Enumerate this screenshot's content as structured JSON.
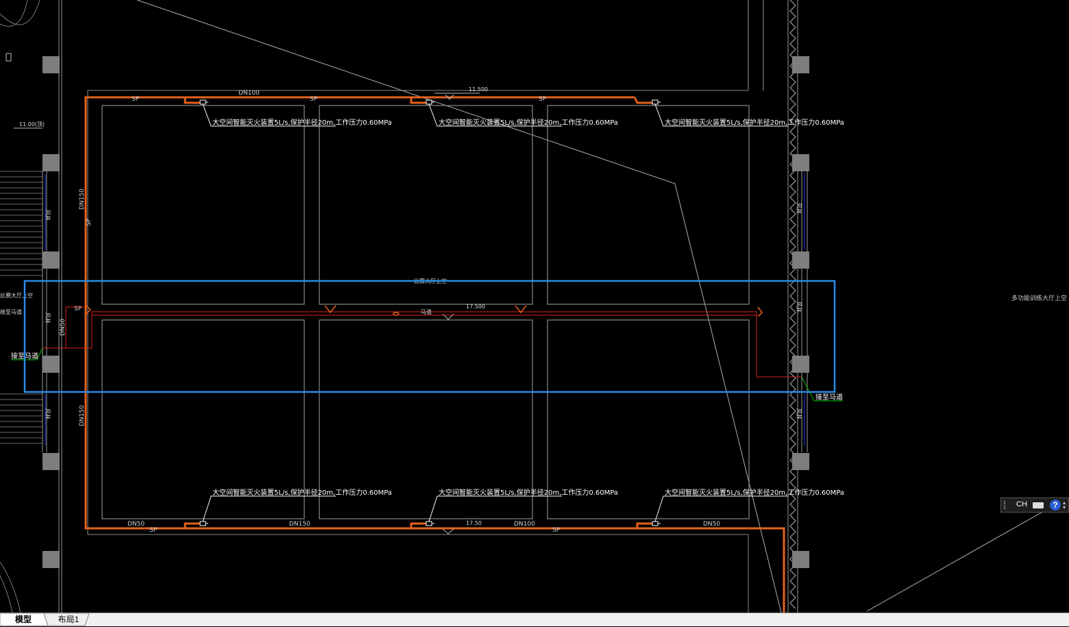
{
  "drawing": {
    "device_label": "大空间智能灭火装置5L/s,保护半径20m,工作压力0.60MPa",
    "device_label_alt": "大空间智能灭火装置5L/s,保护半径20m,工作压力0.60MPa",
    "pipe_labels": {
      "dn100": "DN100",
      "dn150": "DN150",
      "dn50": "DN50",
      "sp": "SP",
      "sp_rotated": "SP"
    },
    "elevation_left": "11.00(顶)",
    "elevation_top": "11.500",
    "elevation_mid": "17.500",
    "elevation_bottom": "17.50",
    "catwalk_label": "马道",
    "hall_label_center": "比赛大厅上空",
    "hall_label_right": "多功能训练大厅上空",
    "shaft_label": "风井",
    "catwalk_link_label": "接至马道",
    "left_partial_label_1": "比赛大厅上空",
    "left_partial_label_2": "接至马道"
  },
  "colors": {
    "background": "#000000",
    "main_pipe": "#e8621e",
    "thin_pipe": "#e02020",
    "selection": "#2b8ce8",
    "outline": "#8a8a8a",
    "leader": "#00c000"
  },
  "ime": {
    "lang": "CH",
    "keyboard_icon": "keyboard-icon",
    "help_icon": "help-icon",
    "help_glyph": "?"
  },
  "tabs": [
    {
      "label": "模型",
      "active": true
    },
    {
      "label": "布局1",
      "active": false
    }
  ]
}
